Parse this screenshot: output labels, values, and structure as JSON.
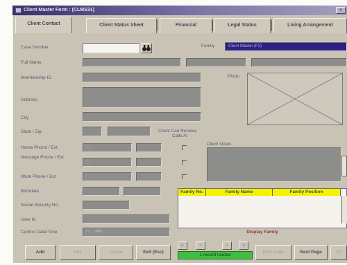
{
  "window": {
    "title": "Client Master Form : (CLMS31)",
    "close_symbol": "✕"
  },
  "tabs": [
    {
      "label": "Client Contact",
      "active": true
    },
    {
      "label": "Client Status Sheet"
    },
    {
      "label": "Financial"
    },
    {
      "label": "Legal Status"
    },
    {
      "label": "Living Arrangement"
    }
  ],
  "form": {
    "case_number_label": "Case Number",
    "full_name_label": "Full Name",
    "membership_label": "Membership ID",
    "address_label": "Address",
    "city_label": "City",
    "state_zip_label": "State / Zip",
    "home_phone_label": "Home Phone / Ext",
    "message_phone_label": "Message Phone / Ext",
    "work_phone_label": "Work Phone / Ext",
    "birthdate_label": "Birthdate",
    "ssn_label": "Social Security No.",
    "userid_label": "User Id",
    "control_label": "Control Date/Time",
    "family_label": "Family",
    "family_value": "Client Master (F2)",
    "photo_label": "Photo",
    "client_can_receive_label": "Client Can Receive",
    "calls_at_label": "Calls At",
    "client_notes_label": "Client Notes",
    "phone_placeholder": "(   )   -",
    "control_value": "  /  /     :  :  AM",
    "search_icon": "binoculars-icon"
  },
  "family_table": {
    "columns": [
      "Family No.",
      "Family Name",
      "Family Position"
    ],
    "header_color": "#f3f300",
    "footer_label": "Display Family"
  },
  "status": {
    "text": "1 record loaded",
    "color": "#3fbf3f"
  },
  "buttons": {
    "add": "Add",
    "edit": "Edit",
    "delete": "Delete",
    "exit": "Exit (Esc)",
    "previous_page": "Prev Page",
    "next_page": "Next Page",
    "more": "Pr"
  },
  "record_nav": {
    "first": "|<",
    "prev": "<",
    "next": ">",
    "last": ">|"
  }
}
